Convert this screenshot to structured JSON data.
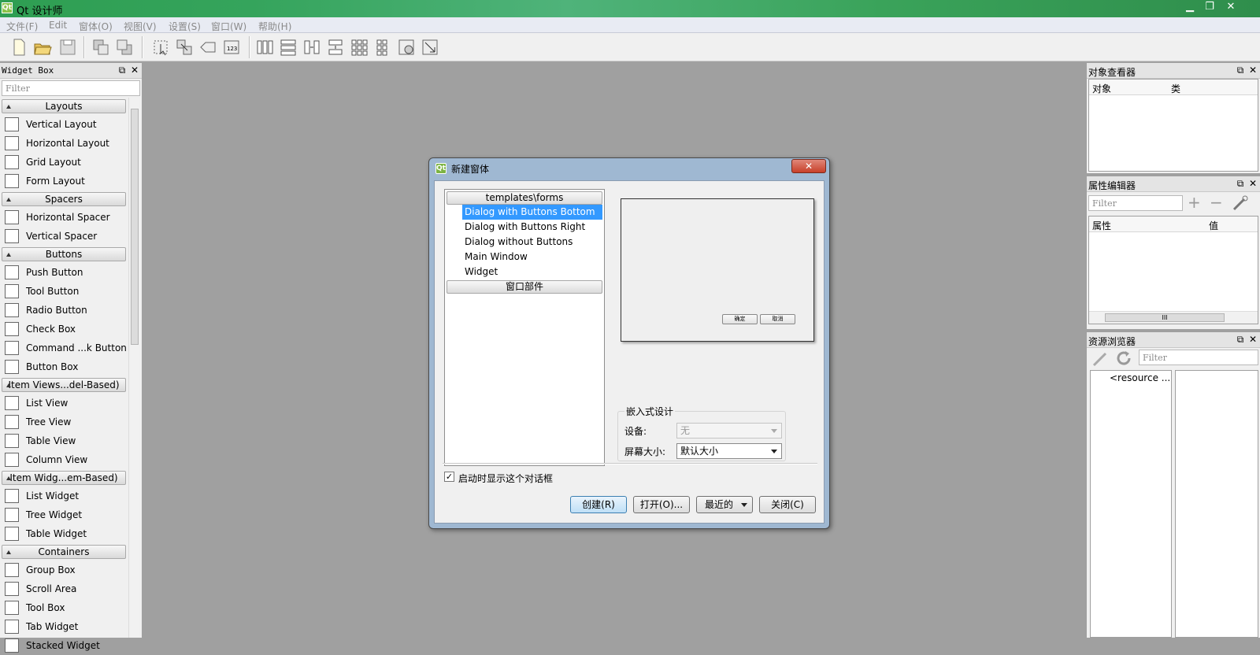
{
  "window": {
    "title": "Qt 设计师",
    "app_icon": "qt-icon",
    "controls": [
      "minimize",
      "restore",
      "close"
    ]
  },
  "menu": [
    "文件(F)",
    "Edit",
    "窗体(O)",
    "视图(V)",
    "设置(S)",
    "窗口(W)",
    "帮助(H)"
  ],
  "toolbar": {
    "icons": [
      "new-form-icon",
      "open-form-icon",
      "save-form-icon",
      "send-to-back-icon",
      "bring-to-front-icon",
      "edit-widgets-icon",
      "edit-signals-slots-icon",
      "edit-buddies-icon",
      "edit-tab-order-icon",
      "layout-horizontal-icon",
      "layout-vertical-icon",
      "layout-horizontal-splitter-icon",
      "layout-vertical-splitter-icon",
      "layout-grid-icon",
      "layout-form-icon",
      "break-layout-icon",
      "adjust-size-icon"
    ]
  },
  "widget_box": {
    "title": "Widget Box",
    "filter_placeholder": "Filter",
    "categories": [
      {
        "name": "Layouts",
        "items": [
          "Vertical Layout",
          "Horizontal Layout",
          "Grid Layout",
          "Form Layout"
        ]
      },
      {
        "name": "Spacers",
        "items": [
          "Horizontal Spacer",
          "Vertical Spacer"
        ]
      },
      {
        "name": "Buttons",
        "items": [
          "Push Button",
          "Tool Button",
          "Radio Button",
          "Check Box",
          "Command ...k Button",
          "Button Box"
        ]
      },
      {
        "name": "Item Views...del-Based)",
        "items": [
          "List View",
          "Tree View",
          "Table View",
          "Column View"
        ]
      },
      {
        "name": "Item Widg...em-Based)",
        "items": [
          "List Widget",
          "Tree Widget",
          "Table Widget"
        ]
      },
      {
        "name": "Containers",
        "items": [
          "Group Box",
          "Scroll Area",
          "Tool Box",
          "Tab Widget",
          "Stacked Widget"
        ]
      }
    ]
  },
  "object_inspector": {
    "title": "对象查看器",
    "col_object": "对象",
    "col_class": "类"
  },
  "property_editor": {
    "title": "属性编辑器",
    "filter_placeholder": "Filter",
    "col_property": "属性",
    "col_value": "值",
    "hscroll_label": "III"
  },
  "resource_browser": {
    "title": "资源浏览器",
    "filter_placeholder": "Filter",
    "root": "<resource ..."
  },
  "dialog": {
    "title": "新建窗体",
    "close_glyph": "✕",
    "tree_category": "templates\\forms",
    "templates": [
      "Dialog with Buttons Bottom",
      "Dialog with Buttons Right",
      "Dialog without Buttons",
      "Main Window",
      "Widget"
    ],
    "selected_template": "Dialog with Buttons Bottom",
    "tree_category2": "窗口部件",
    "preview_buttons": [
      "确定",
      "取消"
    ],
    "embedded_group": "嵌入式设计",
    "device_label": "设备:",
    "device_value": "无",
    "screen_label": "屏幕大小:",
    "screen_value": "默认大小",
    "show_on_startup": "启动时显示这个对话框",
    "show_on_startup_checked": true,
    "buttons": {
      "create": "创建(R)",
      "open": "打开(O)...",
      "recent": "最近的",
      "close": "关闭(C)"
    }
  }
}
